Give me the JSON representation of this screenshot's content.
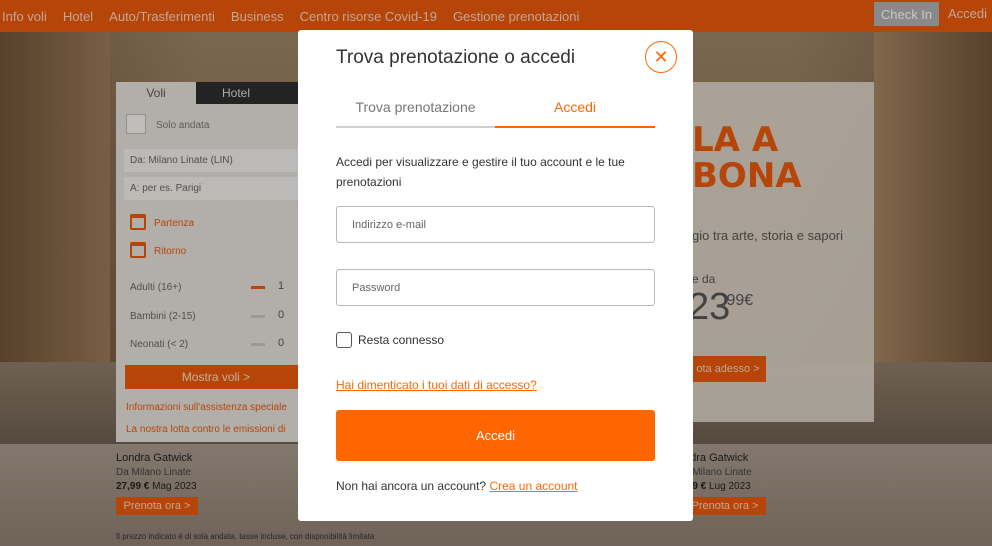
{
  "nav": {
    "items": [
      "Info voli",
      "Hotel",
      "Auto/Trasferimenti",
      "Business",
      "Centro risorse Covid-19",
      "Gestione prenotazioni"
    ],
    "checkin_label": "Check In",
    "login_label": "Accedi"
  },
  "booking": {
    "tabs": [
      "Voli",
      "Hotel"
    ],
    "one_way_label": "Solo andata",
    "from_label": "Da:",
    "from_value": "Milano Linate (LIN)",
    "to_label": "A:",
    "to_placeholder": "per es. Parigi",
    "departure_label": "Partenza",
    "return_label": "Ritorno",
    "passengers": [
      {
        "label": "Adulti (16+)",
        "count": "1"
      },
      {
        "label": "Bambini (2-15)",
        "count": "0"
      },
      {
        "label": "Neonati (< 2)",
        "count": "0"
      }
    ],
    "search_label": "Mostra voli >",
    "links": [
      "Informazioni sull'assistenza speciale",
      "La nostra lotta contro le emissioni di"
    ]
  },
  "promo": {
    "title_line1": "LA A",
    "title_line2": "BONA",
    "subtitle": "gio tra arte, storia e sapori",
    "from_label": "e da",
    "price_main": "23",
    "price_cents": ",99€",
    "cta_label": "ota adesso >"
  },
  "deals": [
    {
      "destination": "Londra Gatwick",
      "origin": "Da Milano Linate",
      "price": "27,99 €",
      "date": "Mag 2023",
      "button": "Prenota ora >"
    },
    {
      "destination": "ndra Gatwick",
      "origin": "a Milano Linate",
      "price": ",49 €",
      "date": "Lug 2023",
      "button": "Prenota ora >"
    }
  ],
  "deals_note": "Il prezzo indicato è di sola andata, tasse incluse, con disponibilità limitata",
  "modal": {
    "title": "Trova prenotazione o accedi",
    "close_icon": "close-icon",
    "tab_find": "Trova prenotazione",
    "tab_login": "Accedi",
    "intro": "Accedi per visualizzare e gestire il tuo account e le tue prenotazioni",
    "email_placeholder": "Indirizzo e-mail",
    "password_placeholder": "Password",
    "remember_label": "Resta connesso",
    "forgot_link": "Hai dimenticato i tuoi dati di accesso?",
    "submit_label": "Accedi",
    "signup_text": "Non hai ancora un account?",
    "signup_link": "Crea un account"
  },
  "colors": {
    "accent": "#ff6600",
    "nav_bg": "#e8590c"
  }
}
